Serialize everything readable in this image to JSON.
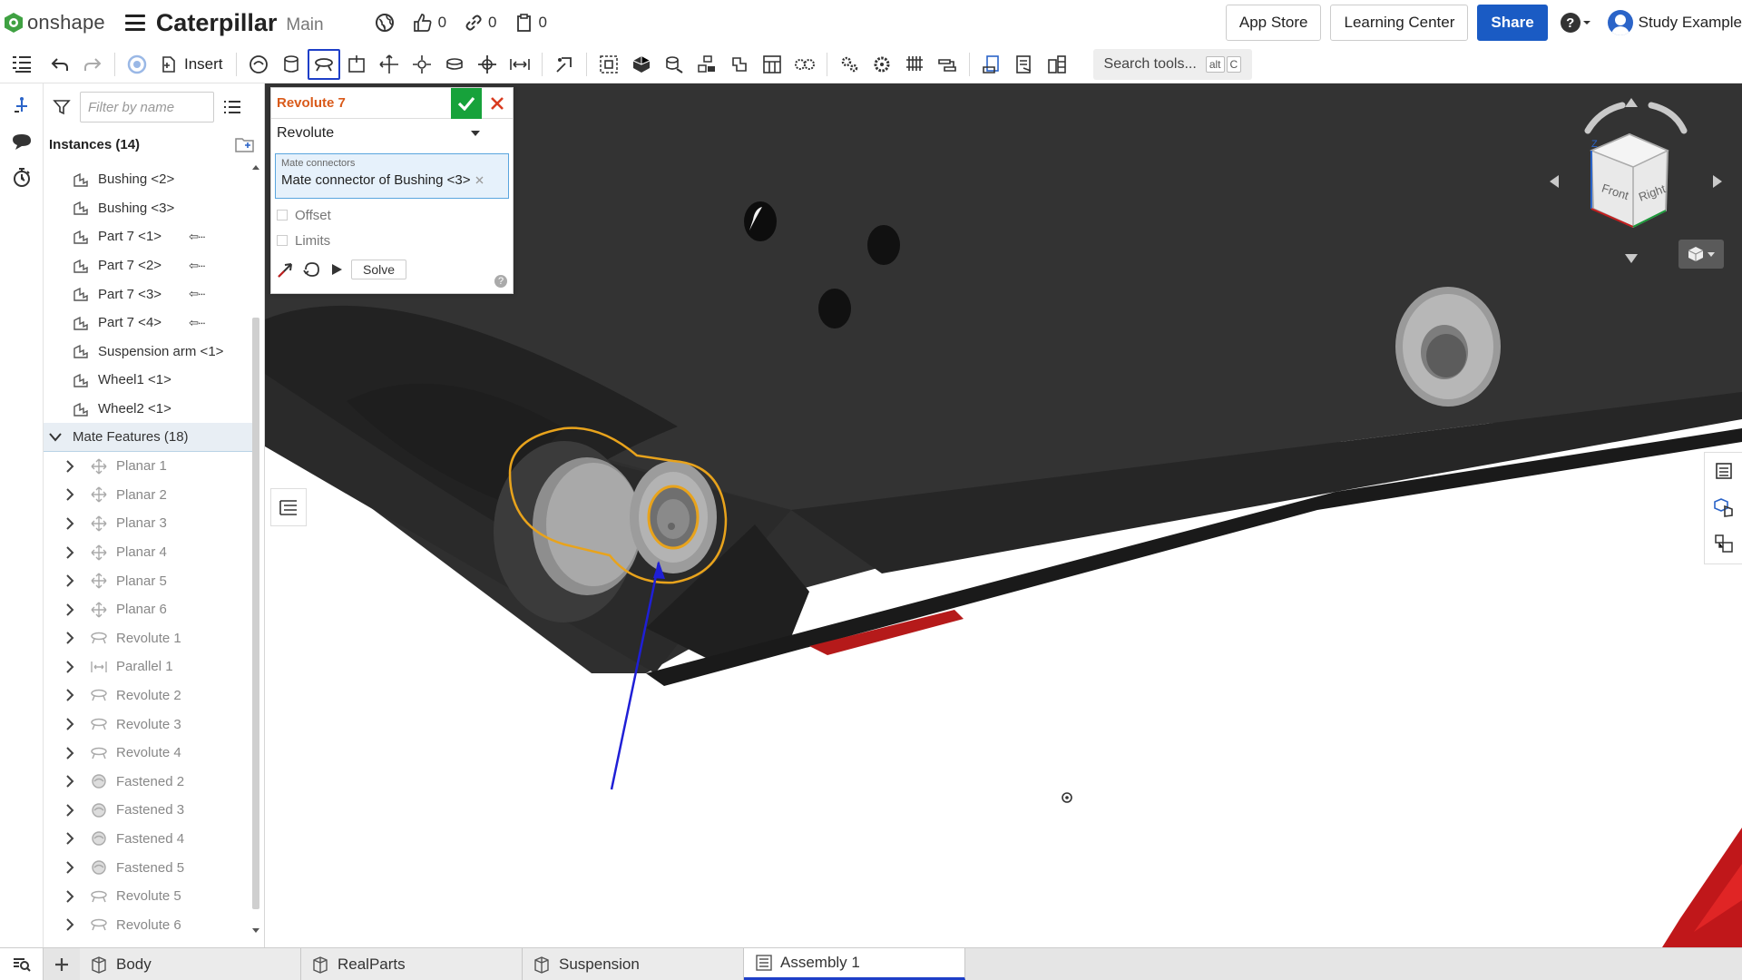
{
  "header": {
    "logo_text": "onshape",
    "doc_title": "Caterpillar",
    "branch": "Main",
    "likes_count": "0",
    "links_count": "0",
    "copies_count": "0",
    "app_store_label": "App Store",
    "learning_center_label": "Learning Center",
    "share_label": "Share",
    "help_label": "?",
    "user_name": "Study Example"
  },
  "toolbar": {
    "insert_label": "Insert",
    "search_placeholder": "Search tools...",
    "shortcut_key1": "alt",
    "shortcut_key2": "C"
  },
  "panel": {
    "filter_placeholder": "Filter by name",
    "instances_header": "Instances (14)",
    "instances": [
      {
        "label": "Bushing <2>",
        "linked": false
      },
      {
        "label": "Bushing <3>",
        "linked": false
      },
      {
        "label": "Part 7 <1>",
        "linked": true
      },
      {
        "label": "Part 7 <2>",
        "linked": true
      },
      {
        "label": "Part 7 <3>",
        "linked": true
      },
      {
        "label": "Part 7 <4>",
        "linked": true
      },
      {
        "label": "Suspension arm <1>",
        "linked": false
      },
      {
        "label": "Wheel1 <1>",
        "linked": false
      },
      {
        "label": "Wheel2 <1>",
        "linked": false
      }
    ],
    "link_glyph": "⇦∙∙∙",
    "mate_features_header": "Mate Features (18)",
    "mates": [
      {
        "label": "Planar 1",
        "icon": "planar-icon"
      },
      {
        "label": "Planar 2",
        "icon": "planar-icon"
      },
      {
        "label": "Planar 3",
        "icon": "planar-icon"
      },
      {
        "label": "Planar 4",
        "icon": "planar-icon"
      },
      {
        "label": "Planar 5",
        "icon": "planar-icon"
      },
      {
        "label": "Planar 6",
        "icon": "planar-icon"
      },
      {
        "label": "Revolute 1",
        "icon": "revolute-icon"
      },
      {
        "label": "Parallel 1",
        "icon": "parallel-icon"
      },
      {
        "label": "Revolute 2",
        "icon": "revolute-icon"
      },
      {
        "label": "Revolute 3",
        "icon": "revolute-icon"
      },
      {
        "label": "Revolute 4",
        "icon": "revolute-icon"
      },
      {
        "label": "Fastened 2",
        "icon": "fastened-icon"
      },
      {
        "label": "Fastened 3",
        "icon": "fastened-icon"
      },
      {
        "label": "Fastened 4",
        "icon": "fastened-icon"
      },
      {
        "label": "Fastened 5",
        "icon": "fastened-icon"
      },
      {
        "label": "Revolute 5",
        "icon": "revolute-icon"
      },
      {
        "label": "Revolute 6",
        "icon": "revolute-icon"
      }
    ]
  },
  "dialog": {
    "title": "Revolute 7",
    "mate_type": "Revolute",
    "field_label": "Mate connectors",
    "field_value": "Mate connector of Bushing <3>",
    "offset_label": "Offset",
    "limits_label": "Limits",
    "solve_label": "Solve",
    "help_label": "?"
  },
  "viewcube": {
    "front_label": "Front",
    "right_label": "Right",
    "axis_z": "Z"
  },
  "tabs": [
    {
      "label": "Body",
      "active": false
    },
    {
      "label": "RealParts",
      "active": false
    },
    {
      "label": "Suspension",
      "active": false
    },
    {
      "label": "Assembly 1",
      "active": true
    }
  ],
  "colors": {
    "accent": "#1a5bc4",
    "dialog_title": "#d95a1a",
    "ok": "#17a23b",
    "cancel": "#d93b1f",
    "selection": "#e8a31c",
    "part": "#2e2e2e"
  }
}
